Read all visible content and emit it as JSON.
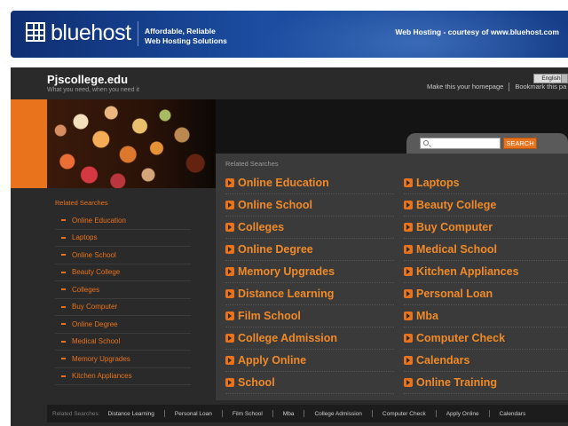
{
  "banner": {
    "logo_text": "bluehost",
    "tagline_line1": "Affordable, Reliable",
    "tagline_line2": "Web Hosting Solutions",
    "courtesy": "Web Hosting - courtesy of www.bluehost.com"
  },
  "site": {
    "title": "Pjscollege.edu",
    "tagline": "What you need, when you need it"
  },
  "top_links": {
    "language": "English",
    "homepage": "Make this your homepage",
    "bookmark": "Bookmark this pa"
  },
  "search": {
    "value": "",
    "button_label": "SEARCH"
  },
  "main": {
    "heading": "Related Searches",
    "left_links": [
      "Online Education",
      "Online School",
      "Colleges",
      "Online Degree",
      "Memory Upgrades",
      "Distance Learning",
      "Film School",
      "College Admission",
      "Apply Online",
      "School"
    ],
    "right_links": [
      "Laptops",
      "Beauty College",
      "Buy Computer",
      "Medical School",
      "Kitchen Appliances",
      "Personal Loan",
      "Mba",
      "Computer Check",
      "Calendars",
      "Online Training"
    ]
  },
  "sidebar": {
    "heading": "Related Searches",
    "items": [
      "Online Education",
      "Laptops",
      "Online School",
      "Beauty College",
      "Colleges",
      "Buy Computer",
      "Online Degree",
      "Medical School",
      "Memory Upgrades",
      "Kitchen Appliances"
    ]
  },
  "footer": {
    "label": "Related Searches:",
    "links": [
      "Distance Learning",
      "Personal Loan",
      "Film School",
      "Mba",
      "College Admission",
      "Computer Check",
      "Apply Online",
      "Calendars"
    ]
  },
  "colors": {
    "accent_orange": "#e8731c",
    "link_orange": "#f08a28",
    "banner_blue": "#1b4da0",
    "page_dark": "#2a2a2a"
  }
}
